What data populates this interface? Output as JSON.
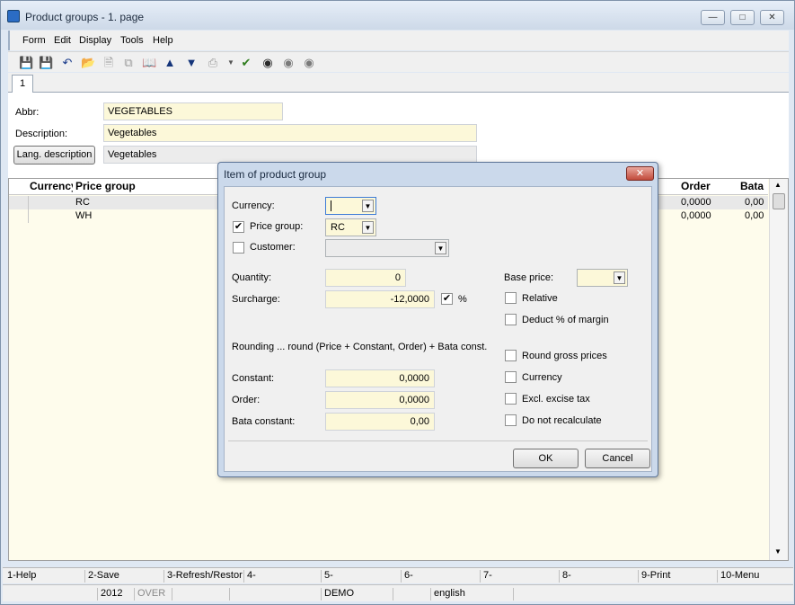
{
  "window": {
    "title": "Product groups - 1. page"
  },
  "menu": [
    "Form",
    "Edit",
    "Display",
    "Tools",
    "Help"
  ],
  "tab": {
    "label": "1"
  },
  "form": {
    "abbr_label": "Abbr:",
    "abbr_value": "VEGETABLES",
    "description_label": "Description:",
    "description_value": "Vegetables",
    "lang_button": "Lang. description",
    "lang_value": "Vegetables"
  },
  "grid": {
    "columns": [
      "Currency",
      "Price group",
      "Order",
      "Bata"
    ],
    "rows": [
      {
        "price_group": "RC",
        "order": "0,0000",
        "bata": "0,00"
      },
      {
        "price_group": "WH",
        "order": "0,0000",
        "bata": "0,00"
      }
    ]
  },
  "function_keys": [
    "1-Help",
    "2-Save",
    "3-Refresh/Restore",
    "4-",
    "5-",
    "6-",
    "7-",
    "8-",
    "9-Print",
    "10-Menu"
  ],
  "status": {
    "year": "2012",
    "mode": "OVER",
    "company": "DEMO",
    "language": "english"
  },
  "dialog": {
    "title": "Item of product group",
    "currency_label": "Currency:",
    "currency_value": "",
    "price_group_label": "Price group:",
    "price_group_value": "RC",
    "price_group_checked": true,
    "customer_label": "Customer:",
    "customer_value": "",
    "customer_checked": false,
    "quantity_label": "Quantity:",
    "quantity_value": "0",
    "surcharge_label": "Surcharge:",
    "surcharge_value": "-12,0000",
    "percent_label": "%",
    "percent_checked": true,
    "base_price_label": "Base price:",
    "base_price_value": "",
    "relative_label": "Relative",
    "deduct_label": "Deduct % of margin",
    "rounding_text": "Rounding ... round (Price + Constant, Order) + Bata const.",
    "constant_label": "Constant:",
    "constant_value": "0,0000",
    "order_label": "Order:",
    "order_value": "0,0000",
    "bata_label": "Bata constant:",
    "bata_value": "0,00",
    "round_gross_label": "Round gross prices",
    "currency_cb_label": "Currency",
    "excise_label": "Excl. excise tax",
    "no_recalc_label": "Do not recalculate",
    "ok_label": "OK",
    "cancel_label": "Cancel"
  }
}
